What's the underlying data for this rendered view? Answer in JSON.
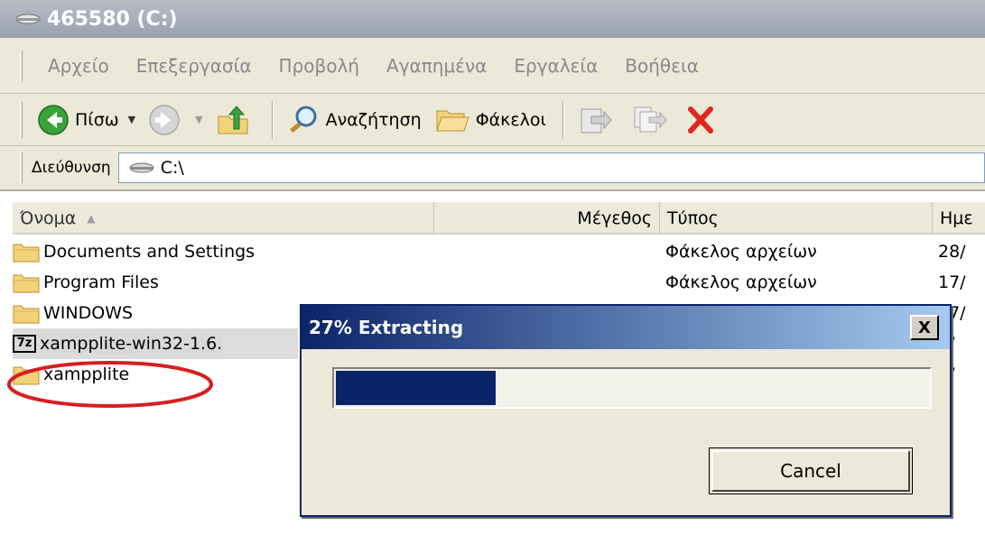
{
  "window": {
    "title": "465580 (C:)"
  },
  "menu": [
    "Αρχείο",
    "Επεξεργασία",
    "Προβολή",
    "Αγαπημένα",
    "Εργαλεία",
    "Βοήθεια"
  ],
  "toolbar": {
    "back_label": "Πίσω",
    "search_label": "Αναζήτηση",
    "folders_label": "Φάκελοι"
  },
  "address": {
    "label": "Διεύθυνση",
    "value": "C:\\"
  },
  "columns": {
    "name": "Όνομα",
    "size": "Μέγεθος",
    "type": "Τύπος",
    "date": "Ημε"
  },
  "files": [
    {
      "name": "Documents and Settings",
      "type": "Φάκελος αρχείων",
      "date": "28/",
      "icon": "folder-icon"
    },
    {
      "name": "Program Files",
      "type": "Φάκελος αρχείων",
      "date": "17/",
      "icon": "folder-icon"
    },
    {
      "name": "WINDOWS",
      "type": "",
      "date": "17/",
      "icon": "folder-icon"
    },
    {
      "name": "xampplite-win32-1.6.",
      "type": "",
      "date": "8/",
      "icon": "7z-archive-icon"
    },
    {
      "name": "xampplite",
      "type": "",
      "date": "8/",
      "icon": "folder-icon"
    }
  ],
  "dialog": {
    "title": "27% Extracting",
    "progress": 0.27,
    "cancel_label": "Cancel",
    "close_label": "X"
  },
  "colors": {
    "annotation": "#d61f1f",
    "progress_fill": "#0a246a",
    "folder": "#f3d27a"
  }
}
